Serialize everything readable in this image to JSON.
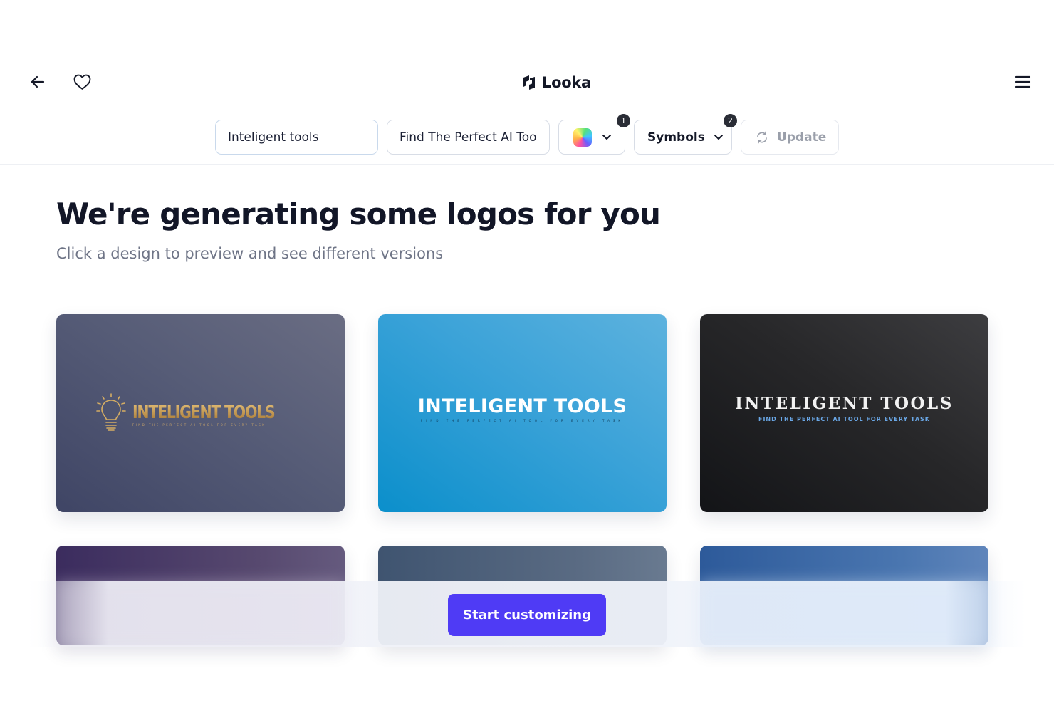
{
  "header": {
    "brand_name": "Looka",
    "back_icon": "arrow-left-icon",
    "favorite_icon": "heart-icon",
    "menu_icon": "hamburger-menu-icon"
  },
  "toolbar": {
    "company_name_value": "Inteligent tools",
    "slogan_value": "Find The Perfect AI Too",
    "color_filter_count": "1",
    "symbols_label": "Symbols",
    "symbols_filter_count": "2",
    "update_label": "Update"
  },
  "main": {
    "title": "We're generating some logos for you",
    "subtitle": "Click a design to preview and see different versions"
  },
  "logos": [
    {
      "name": "INTELIGENT TOOLS",
      "tagline": "FIND THE PERFECT AI TOOL FOR EVERY TASK",
      "icon": "lightbulb-icon"
    },
    {
      "name": "INTELIGENT TOOLS",
      "tagline": "FIND THE PERFECT AI TOOL FOR EVERY TASK"
    },
    {
      "name": "INTELIGENT TOOLS",
      "tagline": "FIND THE PERFECT AI TOOL FOR EVERY TASK"
    }
  ],
  "cta": {
    "label": "Start customizing"
  },
  "colors": {
    "accent": "#4f3bf5",
    "title": "#121627",
    "subtitle": "#6e7486"
  }
}
